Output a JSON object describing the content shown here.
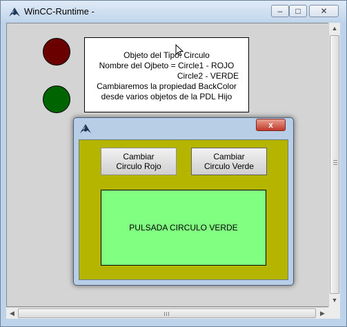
{
  "window": {
    "title": "WinCC-Runtime -",
    "minimize_glyph": "–",
    "maximize_glyph": "□",
    "close_glyph": "✕"
  },
  "info": {
    "line1": "Objeto del Tipo: Circulo",
    "line2": "Nombre del Ojbeto = Circle1 - ROJO",
    "line3": "Circle2 - VERDE",
    "line4": "Cambiaremos la propiedad BackColor",
    "line5": "desde varios objetos de la PDL  Hijo"
  },
  "circles": [
    {
      "name": "Circle1",
      "color": "#6b0000"
    },
    {
      "name": "Circle2",
      "color": "#006400"
    }
  ],
  "popup": {
    "close_glyph": "x",
    "button_red_line1": "Cambiar",
    "button_red_line2": "Circulo Rojo",
    "button_green_line1": "Cambiar",
    "button_green_line2": "Circulo Verde",
    "status_text": "PULSADA CIRCULO VERDE",
    "panel_color": "#b5b500",
    "status_color": "#80ff80"
  },
  "scroll": {
    "up": "▲",
    "down": "▼",
    "left": "◀",
    "right": "▶"
  }
}
